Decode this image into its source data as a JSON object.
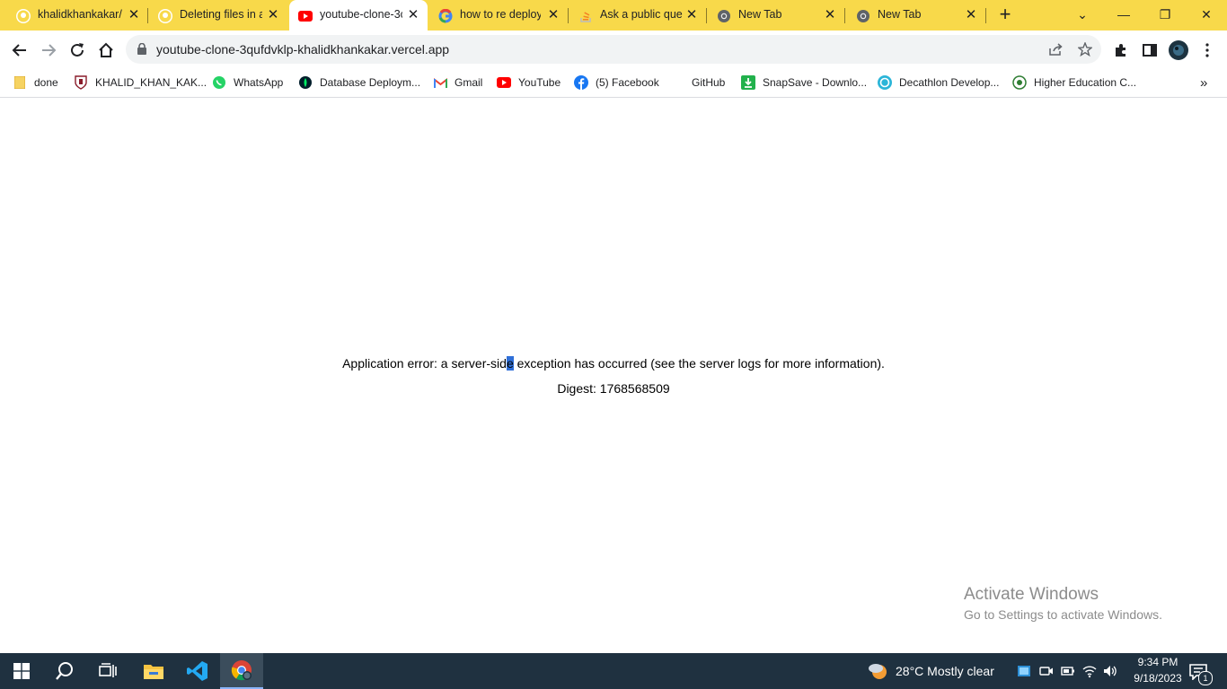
{
  "tabs": [
    {
      "title": "khalidkhankakar/",
      "icon": "github-icon"
    },
    {
      "title": "Deleting files in a",
      "icon": "github-icon"
    },
    {
      "title": "youtube-clone-3c",
      "icon": "youtube-icon",
      "active": true
    },
    {
      "title": "how to re deploy",
      "icon": "google-icon"
    },
    {
      "title": "Ask a public ques",
      "icon": "stackoverflow-icon"
    },
    {
      "title": "New Tab",
      "icon": "chrome-icon"
    },
    {
      "title": "New Tab",
      "icon": "chrome-icon"
    }
  ],
  "address_bar": {
    "url": "youtube-clone-3qufdvklp-khalidkhankakar.vercel.app"
  },
  "bookmarks": [
    {
      "label": "done",
      "icon": "folder-icon"
    },
    {
      "label": "KHALID_KHAN_KAK...",
      "icon": "university-icon"
    },
    {
      "label": "WhatsApp",
      "icon": "whatsapp-icon"
    },
    {
      "label": "Database Deploym...",
      "icon": "database-icon"
    },
    {
      "label": "Gmail",
      "icon": "gmail-icon"
    },
    {
      "label": "YouTube",
      "icon": "youtube-icon"
    },
    {
      "label": "(5) Facebook",
      "icon": "facebook-icon"
    },
    {
      "label": "GitHub",
      "icon": "github-icon"
    },
    {
      "label": "SnapSave - Downlo...",
      "icon": "download-icon"
    },
    {
      "label": "Decathlon Develop...",
      "icon": "decathlon-icon"
    },
    {
      "label": "Higher Education C...",
      "icon": "hec-icon"
    }
  ],
  "page": {
    "error_before": "Application error: a server-sid",
    "error_selected": "e",
    "error_after": " exception has occurred (see the server logs for more information).",
    "digest": "Digest: 1768568509"
  },
  "watermark": {
    "title": "Activate Windows",
    "subtitle": "Go to Settings to activate Windows."
  },
  "taskbar": {
    "weather": "28°C  Mostly clear",
    "time": "9:34 PM",
    "date": "9/18/2023",
    "notification_count": "1"
  },
  "colors": {
    "tab_strip": "#f8d94a",
    "taskbar": "#1f3140",
    "selection": "#2f6fd8"
  }
}
